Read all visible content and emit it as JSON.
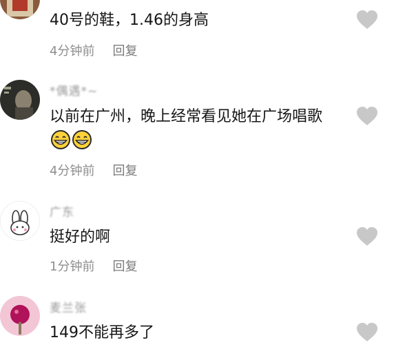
{
  "comments": [
    {
      "username": "",
      "text": "40号的鞋，1.46的身高",
      "time": "4分钟前",
      "reply_label": "回复"
    },
    {
      "username": "*偶遇*~",
      "text": "以前在广州，晚上经常看见她在广场唱歌",
      "emoji": [
        "grin-emoji",
        "grin-emoji"
      ],
      "time": "4分钟前",
      "reply_label": "回复"
    },
    {
      "username": "广东",
      "text": "挺好的啊",
      "time": "1分钟前",
      "reply_label": "回复"
    },
    {
      "username": "麦兰张",
      "text": "149不能再多了"
    }
  ],
  "colors": {
    "text": "#161616",
    "meta": "#8e8e8e",
    "heart": "#c8c8c8"
  },
  "icons": {
    "like": "heart-icon",
    "emoji": "grin-emoji"
  }
}
